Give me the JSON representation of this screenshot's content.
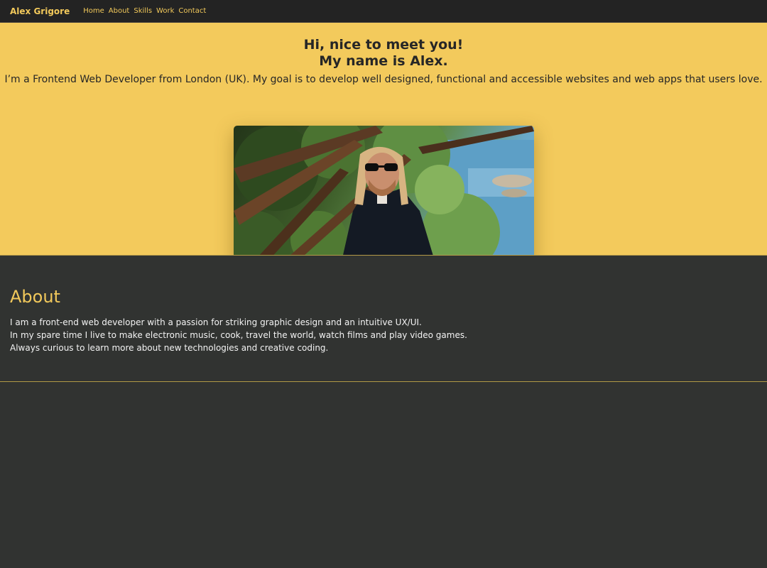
{
  "nav": {
    "brand": "Alex Grigore",
    "links": [
      "Home",
      "About",
      "Skills",
      "Work",
      "Contact"
    ]
  },
  "hero": {
    "heading_line1": "Hi, nice to meet you!",
    "heading_line2": "My name is Alex.",
    "intro": "I’m a Frontend Web Developer from London (UK). My goal is to develop well designed, functional and accessible websites and web apps that users love."
  },
  "about": {
    "title": "About",
    "lines": [
      "I am a front-end web developer with a passion for striking graphic design and an intuitive UX/UI.",
      "In my spare time I live to make electronic music, cook, travel the world, watch films and play video games.",
      "Always curious to learn more about new technologies and creative coding."
    ]
  },
  "colors": {
    "accent": "#f2c95b",
    "hero_bg": "#f3ca5c",
    "navbar_bg": "#232323",
    "page_bg": "#313331"
  }
}
